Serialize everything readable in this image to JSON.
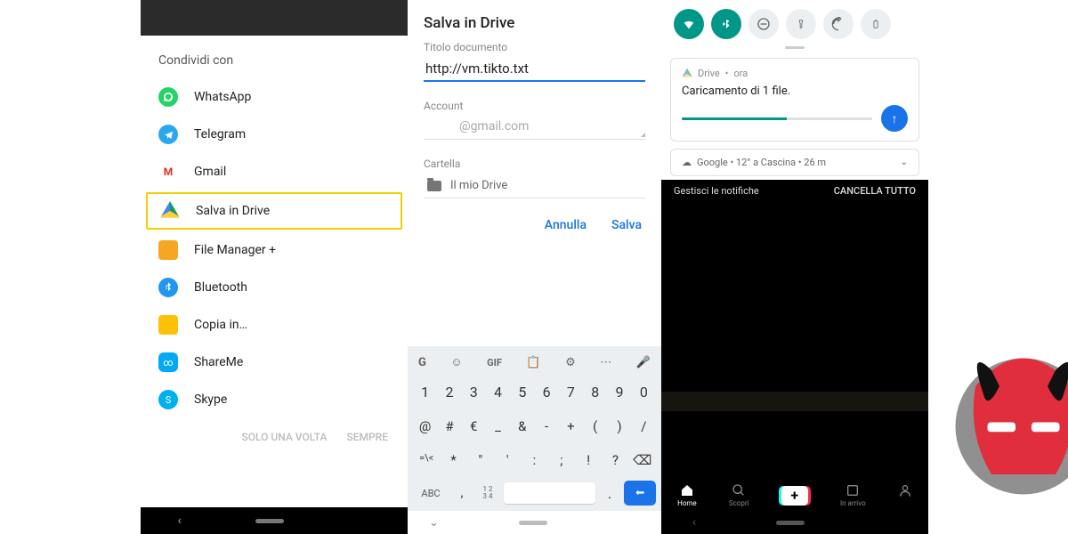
{
  "share": {
    "title": "Condividi con",
    "items": [
      {
        "label": "WhatsApp"
      },
      {
        "label": "Telegram"
      },
      {
        "label": "Gmail"
      },
      {
        "label": "Salva in Drive"
      },
      {
        "label": "File Manager +"
      },
      {
        "label": "Bluetooth"
      },
      {
        "label": "Copia in…"
      },
      {
        "label": "ShareMe"
      },
      {
        "label": "Skype"
      }
    ],
    "actions": {
      "once": "SOLO UNA VOLTA",
      "always": "SEMPRE"
    }
  },
  "save": {
    "title": "Salva in Drive",
    "field_title_label": "Titolo documento",
    "field_title_value": "http://vm.tikto.txt",
    "field_account_label": "Account",
    "field_account_value": "@gmail.com",
    "field_folder_label": "Cartella",
    "field_folder_value": "Il mio Drive",
    "cancel": "Annulla",
    "ok": "Salva"
  },
  "keyboard": {
    "top": {
      "gif": "GIF"
    },
    "row1": [
      "1",
      "2",
      "3",
      "4",
      "5",
      "6",
      "7",
      "8",
      "9",
      "0"
    ],
    "row2": [
      "@",
      "#",
      "€",
      "_",
      "&",
      "-",
      "+",
      "(",
      ")",
      "/"
    ],
    "row3": [
      "=\\<",
      "*",
      "\"",
      "'",
      ":",
      ";",
      "!",
      "?",
      "⌫"
    ],
    "abc": "ABC",
    "sup1": "1 2",
    "sup2": "3 4"
  },
  "notif": {
    "drive_app": "Drive",
    "drive_time": "ora",
    "drive_title": "Caricamento di 1 file.",
    "weather": "Google • 12° a Cascina • 26 m",
    "manage": "Gestisci le notifiche",
    "clear": "CANCELLA TUTTO"
  },
  "tiktok": {
    "home": "Home",
    "discover": "Scopri",
    "inbox": "In arrivo"
  }
}
